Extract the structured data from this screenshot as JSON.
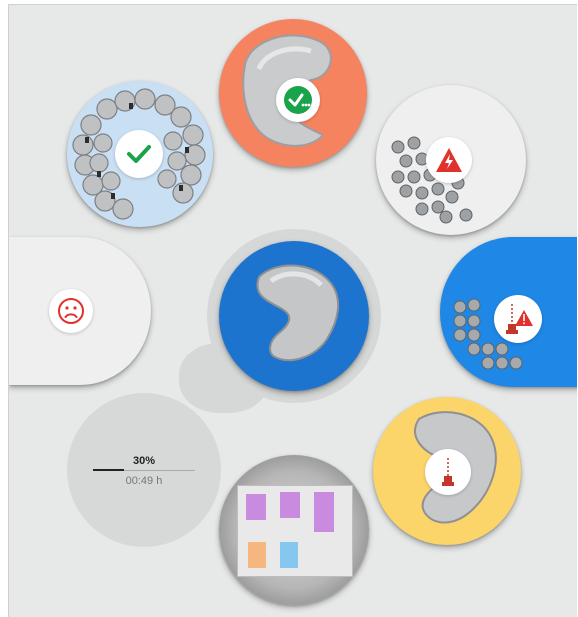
{
  "progress": {
    "percent_label": "30%",
    "time_label": "00:49 h",
    "fraction": 0.3
  },
  "colors": {
    "background": "#e7e8e8",
    "accent_blue": "#1f87e6",
    "center_blue": "#1d74cf",
    "salmon": "#f6835f",
    "yellow": "#fbd56a",
    "light_blue": "#c9dff3",
    "light_gray": "#efefef",
    "success_green": "#19a34a",
    "alert_red": "#e0312c"
  },
  "nodes": [
    {
      "name": "scan-complete-node",
      "icon": "check-icon"
    },
    {
      "name": "model-complete-node",
      "icon": "check-pending-icon"
    },
    {
      "name": "supports-error-node",
      "icon": "lightning-warning-icon"
    },
    {
      "name": "feedback-node",
      "icon": "sad-face-icon"
    },
    {
      "name": "center-model-node",
      "icon": "aligner-model-icon"
    },
    {
      "name": "nesting-warning-node",
      "icon": "tower-warning-icon"
    },
    {
      "name": "support-generation-node",
      "icon": "support-tower-icon"
    },
    {
      "name": "build-platform-node",
      "icon": "build-plate-icon"
    }
  ]
}
